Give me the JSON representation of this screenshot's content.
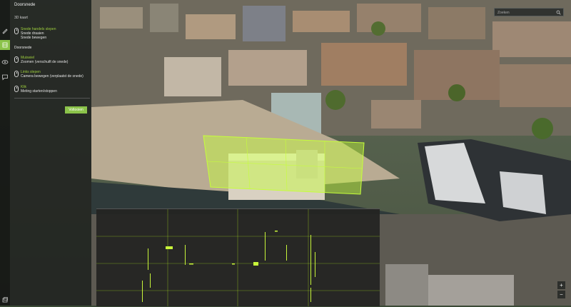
{
  "panel": {
    "title": "Doorsnede",
    "mode_3d": "3D kaart",
    "hints_top": [
      {
        "head": "Snede handels slepen",
        "lines": [
          "Snede draaien",
          "Snede bewegen"
        ]
      }
    ],
    "section2_title": "Doorsnede",
    "hints_bottom": [
      {
        "head": "Muiswiel",
        "lines": [
          "Zoomen (verschuift de snede)"
        ]
      },
      {
        "head": "Links slepen",
        "lines": [
          "Camera bewegen (verplaatst de snede)"
        ]
      },
      {
        "head": "Klik",
        "lines": [
          "Meting starten/stoppen"
        ]
      }
    ],
    "finish_label": "Voltooien"
  },
  "search": {
    "placeholder": "Zoeken"
  },
  "zoom": {
    "in": "+",
    "out": "−"
  },
  "colors": {
    "accent": "#8bc34a",
    "section_plane": "#c6ff3a",
    "profile_points": "#b8f21c",
    "panel_bg": "#202220"
  },
  "icons": [
    "pencil-icon",
    "section-icon",
    "eye-icon",
    "comment-icon",
    "mouse-icon",
    "search-icon",
    "layers-icon"
  ]
}
